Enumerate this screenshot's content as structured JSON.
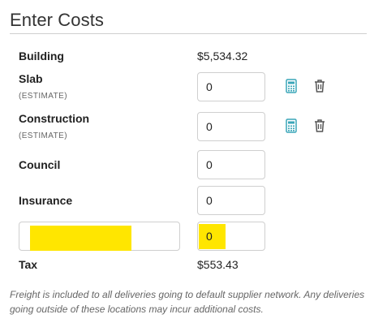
{
  "page": {
    "title": "Enter Costs"
  },
  "rows": {
    "building": {
      "label": "Building",
      "value": "$5,534.32"
    },
    "slab": {
      "label": "Slab",
      "sublabel": "(ESTIMATE)",
      "value": "0",
      "icon_calc": "calculator-icon",
      "icon_delete": "trash-icon"
    },
    "construction": {
      "label": "Construction",
      "sublabel": "(ESTIMATE)",
      "value": "0",
      "icon_calc": "calculator-icon",
      "icon_delete": "trash-icon"
    },
    "council": {
      "label": "Council",
      "value": "0"
    },
    "insurance": {
      "label": "Insurance",
      "value": "0"
    },
    "custom": {
      "name_value": "",
      "amount_value": "0"
    },
    "tax": {
      "label": "Tax",
      "value": "$553.43"
    }
  },
  "note": "Freight is included to all deliveries going to default supplier network. Any deliveries going outside of these locations may incur additional costs.",
  "colors": {
    "highlight": "#ffe600",
    "calc_icon": "#3aa6b9",
    "trash_icon": "#555555"
  }
}
